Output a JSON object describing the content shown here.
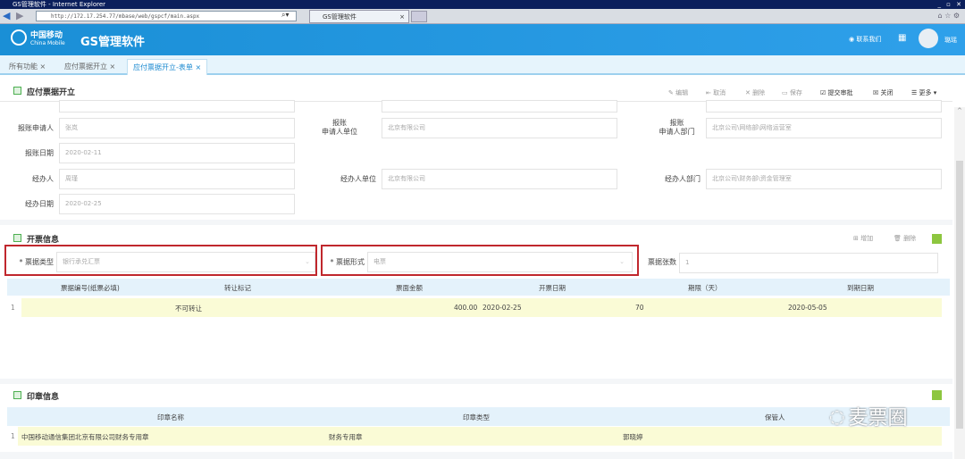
{
  "browser": {
    "title": "GS管理软件 - Internet Explorer",
    "url": "http://172.17.254.77/mbase/web/gspcf/main.aspx",
    "tab": "GS管理软件"
  },
  "header": {
    "logo_cn": "中国移动",
    "logo_en": "China Mobile",
    "app_name": "GS管理软件",
    "contact": "联系我们",
    "user": "璐瑶"
  },
  "tabs": [
    {
      "label": "所有功能"
    },
    {
      "label": "应付票据开立"
    },
    {
      "label": "应付票据开立-表单"
    }
  ],
  "page": {
    "title": "应付票据开立"
  },
  "toolbar": {
    "edit": "编辑",
    "cancel": "取消",
    "delete": "删除",
    "save": "保存",
    "submit": "提交审批",
    "close": "关闭",
    "more": "更多"
  },
  "form": {
    "applicant_label": "报账申请人",
    "applicant": "张岚",
    "applicant_unit_label1": "报账",
    "applicant_unit_label2": "申请人单位",
    "applicant_unit": "北京有限公司",
    "applicant_dept_label1": "报账",
    "applicant_dept_label2": "申请人部门",
    "applicant_dept": "北京公司\\网络部\\网络运营室",
    "date_label": "报账日期",
    "date": "2020-02-11",
    "handler_label": "经办人",
    "handler": "周瑾",
    "handler_unit_label": "经办人单位",
    "handler_unit": "北京有限公司",
    "handler_dept_label": "经办人部门",
    "handler_dept": "北京公司\\财务部\\资金管理室",
    "handle_date_label": "经办日期",
    "handle_date": "2020-02-25"
  },
  "invoice": {
    "title": "开票信息",
    "add": "增加",
    "delete": "删除",
    "type_label": "* 票据类型",
    "type": "银行承兑汇票",
    "form_label": "* 票据形式",
    "form": "电票",
    "count_label": "票据张数",
    "count": "1",
    "columns": [
      "票据编号(纸票必填)",
      "转让标记",
      "票面金额",
      "开票日期",
      "期限（天）",
      "到期日期"
    ],
    "rows": [
      {
        "n": "1",
        "no": "",
        "transfer": "不可转让",
        "amount": "400.00",
        "date": "2020-02-25",
        "days": "70",
        "due": "2020-05-05"
      }
    ]
  },
  "seal": {
    "title": "印章信息",
    "columns": [
      "印章名称",
      "印章类型",
      "保管人"
    ],
    "rows": [
      {
        "n": "1",
        "name": "中国移动通信集团北京有限公司财务专用章",
        "type": "财务专用章",
        "keeper": "郭晓婷"
      }
    ]
  },
  "watermark": "麦票圈"
}
